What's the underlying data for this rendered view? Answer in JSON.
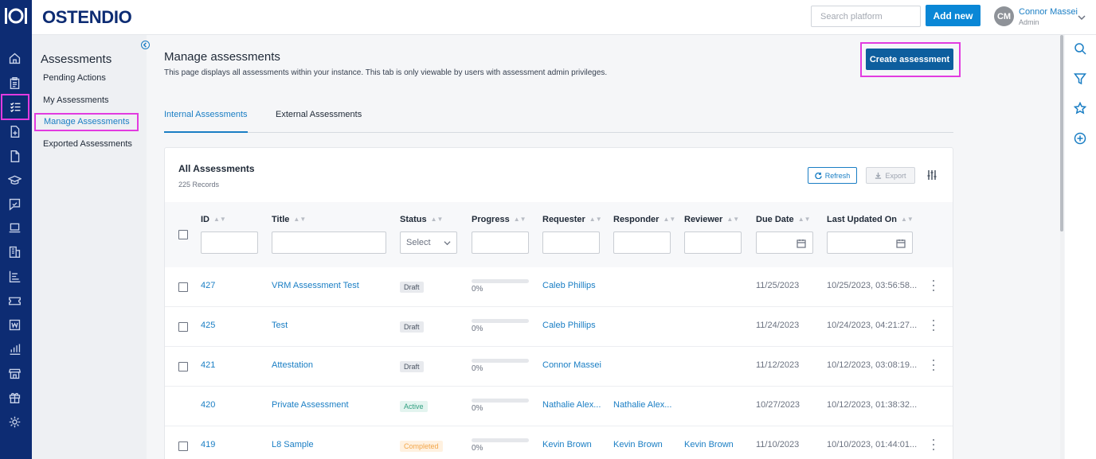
{
  "brand": "OSTENDIO",
  "topbar": {
    "search_placeholder": "Search platform",
    "add_new": "Add new",
    "user_initials": "CM",
    "user_name": "Connor Massei",
    "user_role": "Admin"
  },
  "rail_icons": [
    "home-icon",
    "clipboard-icon",
    "checklist-icon",
    "file-plus-icon",
    "document-icon",
    "graduation-cap-icon",
    "chat-icon",
    "laptop-icon",
    "building-icon",
    "bar-list-icon",
    "ticket-icon",
    "w-icon",
    "chart-icon",
    "store-icon",
    "gift-icon",
    "settings-icon"
  ],
  "sidebar": {
    "title": "Assessments",
    "items": [
      {
        "label": "Pending Actions"
      },
      {
        "label": "My Assessments"
      },
      {
        "label": "Manage Assessments"
      },
      {
        "label": "Exported Assessments"
      }
    ]
  },
  "main": {
    "title": "Manage assessments",
    "description": "This page displays all assessments within your instance. This tab is only viewable by users with assessment admin privileges.",
    "create_button": "Create assessment",
    "tabs": [
      {
        "label": "Internal Assessments"
      },
      {
        "label": "External Assessments"
      }
    ]
  },
  "table": {
    "title": "All Assessments",
    "count": "225 Records",
    "refresh_label": "Refresh",
    "export_label": "Export",
    "columns": [
      "ID",
      "Title",
      "Status",
      "Progress",
      "Requester",
      "Responder",
      "Reviewer",
      "Due Date",
      "Last Updated On"
    ],
    "status_placeholder": "Select",
    "rows": [
      {
        "id": "427",
        "title": "VRM Assessment Test",
        "status": "Draft",
        "progress": 0,
        "progress_text": "0%",
        "requester": "Caleb Phillips",
        "responder": "",
        "reviewer": "",
        "due": "11/25/2023",
        "updated": "10/25/2023, 03:56:58..."
      },
      {
        "id": "425",
        "title": "Test",
        "status": "Draft",
        "progress": 0,
        "progress_text": "0%",
        "requester": "Caleb Phillips",
        "responder": "",
        "reviewer": "",
        "due": "11/24/2023",
        "updated": "10/24/2023, 04:21:27..."
      },
      {
        "id": "421",
        "title": "Attestation",
        "status": "Draft",
        "progress": 0,
        "progress_text": "0%",
        "requester": "Connor Massei",
        "responder": "",
        "reviewer": "",
        "due": "11/12/2023",
        "updated": "10/12/2023, 03:08:19..."
      },
      {
        "id": "420",
        "title": "Private Assessment",
        "status": "Active",
        "progress": 0,
        "progress_text": "0%",
        "requester": "Nathalie Alex...",
        "responder": "Nathalie Alex...",
        "reviewer": "",
        "due": "10/27/2023",
        "updated": "10/12/2023, 01:38:32..."
      },
      {
        "id": "419",
        "title": "L8 Sample",
        "status": "Completed",
        "progress": 0,
        "progress_text": "0%",
        "requester": "Kevin Brown",
        "responder": "Kevin Brown",
        "reviewer": "Kevin Brown",
        "due": "11/10/2023",
        "updated": "10/10/2023, 01:44:01..."
      }
    ]
  },
  "right_tools": [
    "search-icon",
    "filter-icon",
    "star-icon",
    "plus-circle-icon"
  ],
  "colors": {
    "rail": "#0d2c73",
    "accent": "#1a7ec4",
    "highlight": "#e23be0",
    "primary_button": "#0d5e9e"
  }
}
